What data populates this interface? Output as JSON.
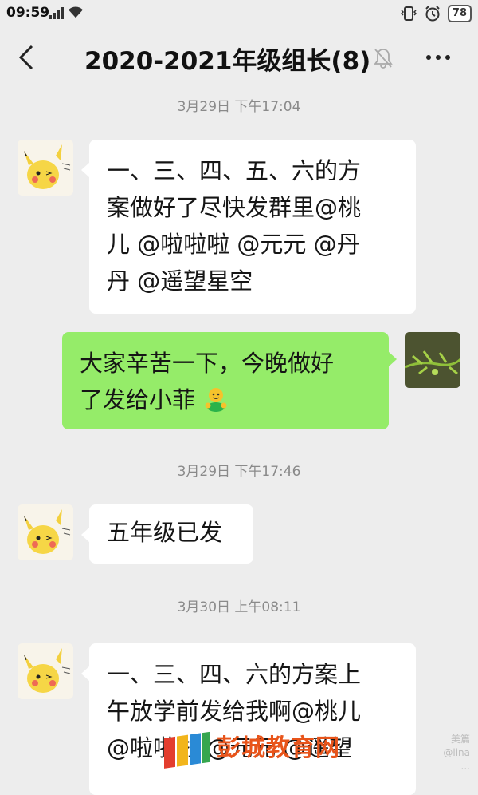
{
  "status_bar": {
    "time": "09:59",
    "network": "4G",
    "battery": "78",
    "icons": [
      "signal-icon",
      "wifi-icon",
      "vibrate-icon",
      "alarm-icon",
      "battery-icon"
    ]
  },
  "header": {
    "title": "2020-2021年级组长(8)",
    "icons": [
      "back-icon",
      "mute-bell-icon",
      "more-icon"
    ]
  },
  "chat": {
    "timestamps": [
      "3月29日 下午17:04",
      "3月29日 下午17:46",
      "3月30日 上午08:11"
    ],
    "messages": [
      {
        "side": "left",
        "text": "一、三、四、五、六的方案做好了尽快发群里@桃儿 @啦啦啦 @元元 @丹丹 @遥望星空",
        "lines": [
          "一、三、四、五、六的方",
          "案做好了尽快发群里@桃",
          "儿 @啦啦啦 @元元 @丹",
          "丹 @遥望星空"
        ]
      },
      {
        "side": "right",
        "text": "大家辛苦一下，今晚做好了发给小菲",
        "lines": [
          "大家辛苦一下，今晚做好",
          "了发给小菲"
        ]
      },
      {
        "side": "left",
        "text": "五年级已发",
        "lines": [
          "五年级已发"
        ]
      },
      {
        "side": "left",
        "text": "一、三、四、六的方案上午放学前发给我啊@桃儿 @啦啦啦 @元元 @遥望",
        "lines": [
          "一、三、四、六的方案上",
          "午放学前发给我啊@桃儿",
          "@啦啦啦 @元元 @遥望"
        ]
      }
    ]
  },
  "watermark": {
    "brand": "彭城教育网",
    "side_top": "美篇",
    "side_mid": "@lina",
    "side_bottom": "..."
  },
  "colors": {
    "background": "#ededed",
    "bubble_self": "#95ec69",
    "bubble_other": "#ffffff",
    "brand": "#e8541a"
  }
}
